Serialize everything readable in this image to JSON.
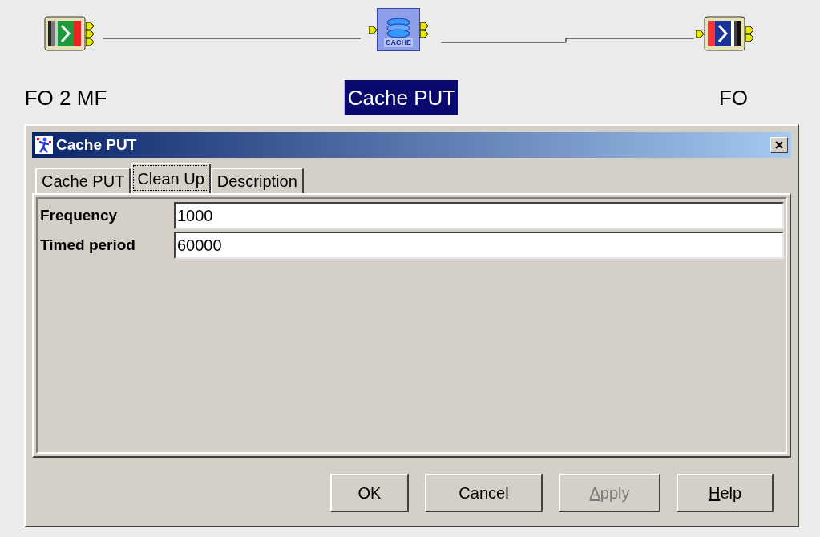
{
  "diagram": {
    "nodes": [
      {
        "kind": "source",
        "label": "FO 2 MF",
        "selected": false
      },
      {
        "kind": "cache",
        "label": "Cache PUT",
        "icon_text": "CACHE",
        "selected": true
      },
      {
        "kind": "target",
        "label": "FO",
        "selected": false
      }
    ]
  },
  "dialog": {
    "title": "Cache PUT",
    "tabs": [
      {
        "label": "Cache PUT",
        "selected": false
      },
      {
        "label": "Clean Up",
        "selected": true
      },
      {
        "label": "Description",
        "selected": false
      }
    ],
    "fields": [
      {
        "label": "Frequency",
        "value": "1000"
      },
      {
        "label": "Timed period",
        "value": "60000"
      }
    ],
    "buttons": [
      {
        "label": "OK",
        "disabled": false,
        "mnemonic": false
      },
      {
        "label": "Cancel",
        "disabled": false,
        "mnemonic": false
      },
      {
        "label": "Apply",
        "disabled": true,
        "mnemonic": true
      },
      {
        "label": "Help",
        "disabled": false,
        "mnemonic": true
      }
    ]
  }
}
